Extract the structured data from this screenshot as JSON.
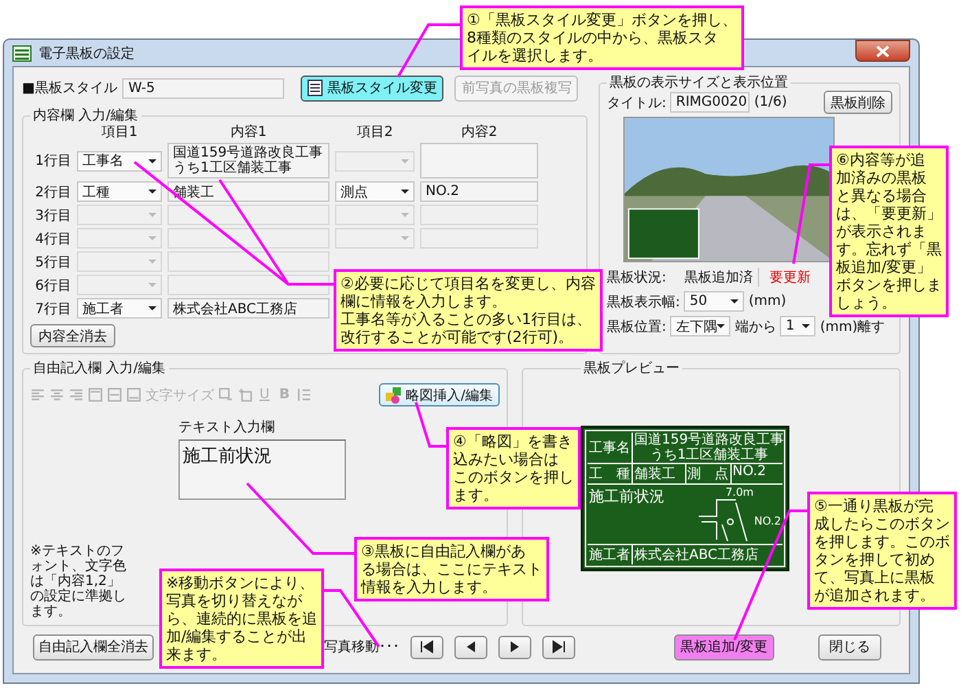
{
  "window": {
    "title": "電子黒板の設定"
  },
  "style_row": {
    "label": "■黒板スタイル",
    "value": "W-5",
    "change_button": "黒板スタイル変更",
    "copy_button": {
      "label": "前写真の黒板複写",
      "disabled": true
    }
  },
  "content_group": {
    "title": "内容欄 入力/編集",
    "columns": [
      "項目1",
      "内容1",
      "項目2",
      "内容2"
    ],
    "rows": [
      {
        "label": "1行目",
        "item1": {
          "text": "工事名",
          "disabled": false
        },
        "content1": {
          "lines": [
            "国道159号道路改良工事",
            "うち1工区舗装工事"
          ],
          "disabled": false
        },
        "item2": {
          "disabled": true
        },
        "content2": {
          "disabled": false
        }
      },
      {
        "label": "2行目",
        "item1": {
          "text": "工種",
          "disabled": false
        },
        "content1": {
          "text": "舗装工",
          "disabled": false
        },
        "item2": {
          "text": "測点",
          "disabled": false
        },
        "content2": {
          "text": "NO.2",
          "disabled": false
        }
      },
      {
        "label": "3行目",
        "item1": {
          "disabled": true
        },
        "content1": {
          "disabled": true
        },
        "item2": {
          "disabled": true
        },
        "content2": {
          "disabled": true
        }
      },
      {
        "label": "4行目",
        "item1": {
          "disabled": true
        },
        "content1": {
          "disabled": true
        },
        "item2": {
          "disabled": true
        },
        "content2": {
          "disabled": true
        }
      },
      {
        "label": "5行目",
        "item1": {
          "disabled": true
        },
        "content1": {
          "disabled": true
        }
      },
      {
        "label": "6行目",
        "item1": {
          "disabled": true
        },
        "content1": {
          "disabled": true
        }
      },
      {
        "label": "7行目",
        "item1": {
          "text": "施工者",
          "disabled": false
        },
        "content1": {
          "text": "株式会社ABC工務店",
          "disabled": false
        }
      }
    ],
    "clear_button": "内容全消去"
  },
  "display_group": {
    "title": "黒板の表示サイズと表示位置",
    "title_label": "タイトル:",
    "title_value": "RIMG0020",
    "counter": "(1/6)",
    "delete_button": "黒板削除",
    "status_label": "黒板状況:",
    "status_value": "黒板追加済",
    "status_alert": "要更新",
    "width_label": "黒板表示幅:",
    "width_value": "50",
    "width_unit": "(mm)",
    "position_label": "黒板位置:",
    "position_value": "左下隅",
    "offset_label": "端から",
    "offset_value": "1",
    "offset_unit": "(mm)離す"
  },
  "free_group": {
    "title": "自由記入欄 入力/編集",
    "toolbar": {
      "disabled": true,
      "font_size_label": "文字サイズ",
      "underline": "U",
      "bold": "B"
    },
    "sketch_button": "略図挿入/編集",
    "text_label": "テキスト入力欄",
    "text_value": "施工前状況",
    "note": "※テキストのフォント、文字色は「内容1,2」の設定に準拠します。"
  },
  "preview": {
    "title": "黒板プレビュー",
    "board": {
      "project_label": "工事名",
      "project_value": [
        "国道159号道路改良工事",
        "うち1工区舗装工事"
      ],
      "type_label": "工　種",
      "type_value": "舗装工",
      "point_label": "測　点",
      "point_value": "NO.2",
      "free_text": "施工前状況",
      "sketch_dimension": "7.0m",
      "sketch_point": "NO.2",
      "contractor_label": "施工者",
      "contractor_value": "株式会社ABC工務店"
    }
  },
  "bottom": {
    "clear_button": "自由記入欄全消去",
    "nav_label": "写真移動･･･",
    "add_button": "黒板追加/変更",
    "close_button": "閉じる"
  },
  "callouts": [
    {
      "lines": [
        "①「黒板スタイル変更」ボタンを押し、",
        "8種類のスタイルの中から、黒板スタ",
        "イルを選択します。"
      ]
    },
    {
      "lines": [
        "②必要に応じて項目名を変更し、内容",
        "欄に情報を入力します。",
        "工事名等が入ることの多い1行目は、",
        "改行することが可能です(2行可)。"
      ]
    },
    {
      "lines": [
        "⑥内容等が追",
        "加済みの黒板",
        "と異なる場合",
        "は、「要更新」",
        "が表示されま",
        "す。忘れず「黒",
        "板追加/変更」",
        "ボタンを押しま",
        "しょう。"
      ]
    },
    {
      "lines": [
        "④「略図」を書き",
        "込みたい場合は",
        "このボタンを押し",
        "ます。"
      ]
    },
    {
      "lines": [
        "※移動ボタンにより、",
        "写真を切り替えなが",
        "ら、連続的に黒板を追",
        "加/編集することが出",
        "来ます。"
      ]
    },
    {
      "lines": [
        "③黒板に自由記入欄があ",
        "る場合は、ここにテキスト",
        "情報を入力します。"
      ]
    },
    {
      "lines": [
        "⑤一通り黒板が完",
        "成したらこのボタン",
        "を押します。このボ",
        "タンを押して初め",
        "て、写真上に黒板",
        "が追加されます。"
      ]
    }
  ]
}
